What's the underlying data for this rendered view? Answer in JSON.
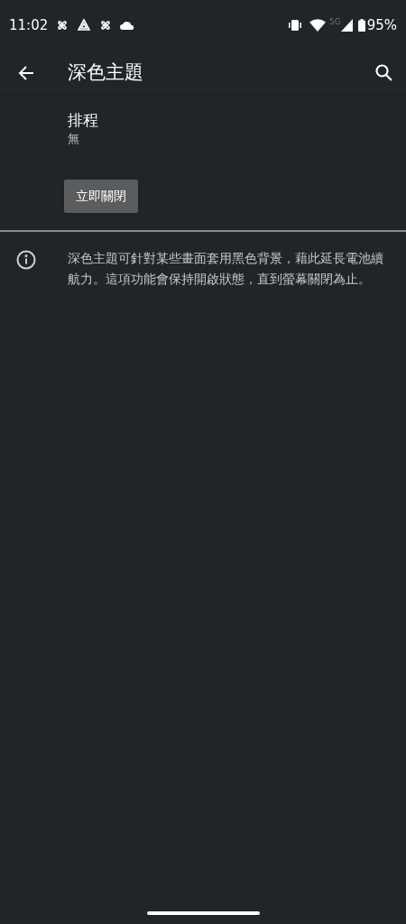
{
  "status_bar": {
    "time": "11:02",
    "network": "5G",
    "battery": "95%"
  },
  "app_bar": {
    "title": "深色主題"
  },
  "schedule": {
    "title": "排程",
    "value": "無"
  },
  "button": {
    "label": "立即關閉"
  },
  "info": {
    "text": "深色主題可針對某些畫面套用黑色背景，藉此延長電池續航力。這項功能會保持開啟狀態，直到螢幕關閉為止。"
  }
}
